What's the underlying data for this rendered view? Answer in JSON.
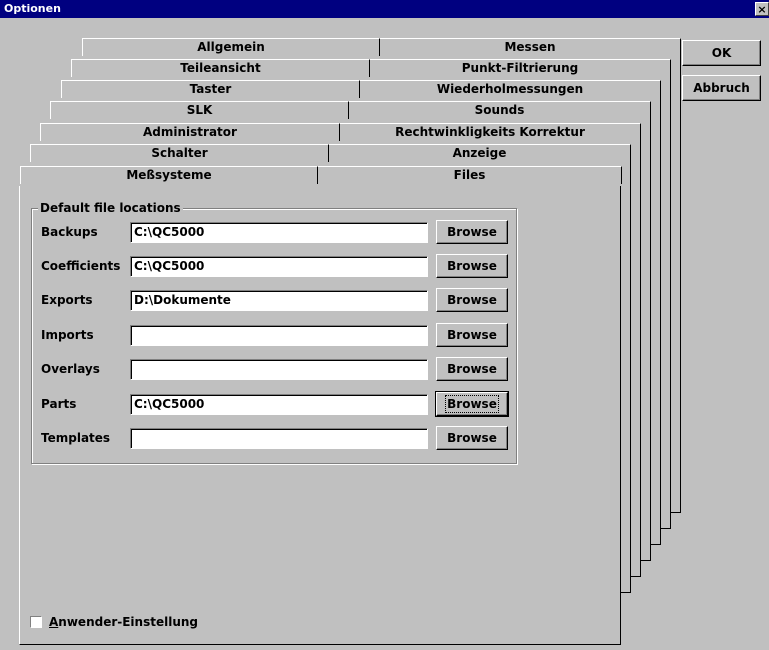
{
  "window": {
    "title": "Optionen",
    "close_glyph": "×"
  },
  "tab_rows": [
    [
      "Allgemein",
      "Messen"
    ],
    [
      "Teileansicht",
      "Punkt-Filtrierung"
    ],
    [
      "Taster",
      "Wiederholmessungen"
    ],
    [
      "SLK",
      "Sounds"
    ],
    [
      "Administrator",
      "Rechtwinkligkeits Korrektur"
    ],
    [
      "Schalter",
      "Anzeige"
    ],
    [
      "Meßsysteme",
      "Files"
    ]
  ],
  "active_tab": "Files",
  "buttons": {
    "ok": "OK",
    "cancel": "Abbruch"
  },
  "group": {
    "label": "Default file locations",
    "browse_label": "Browse",
    "rows": [
      {
        "label": "Backups",
        "value": "C:\\QC5000"
      },
      {
        "label": "Coefficients",
        "value": "C:\\QC5000"
      },
      {
        "label": "Exports",
        "value": "D:\\Dokumente"
      },
      {
        "label": "Imports",
        "value": ""
      },
      {
        "label": "Overlays",
        "value": ""
      },
      {
        "label": "Parts",
        "value": "C:\\QC5000"
      },
      {
        "label": "Templates",
        "value": ""
      }
    ],
    "focused_row": "Parts"
  },
  "checkbox": {
    "label": "Anwender-Einstellung",
    "checked": false
  }
}
